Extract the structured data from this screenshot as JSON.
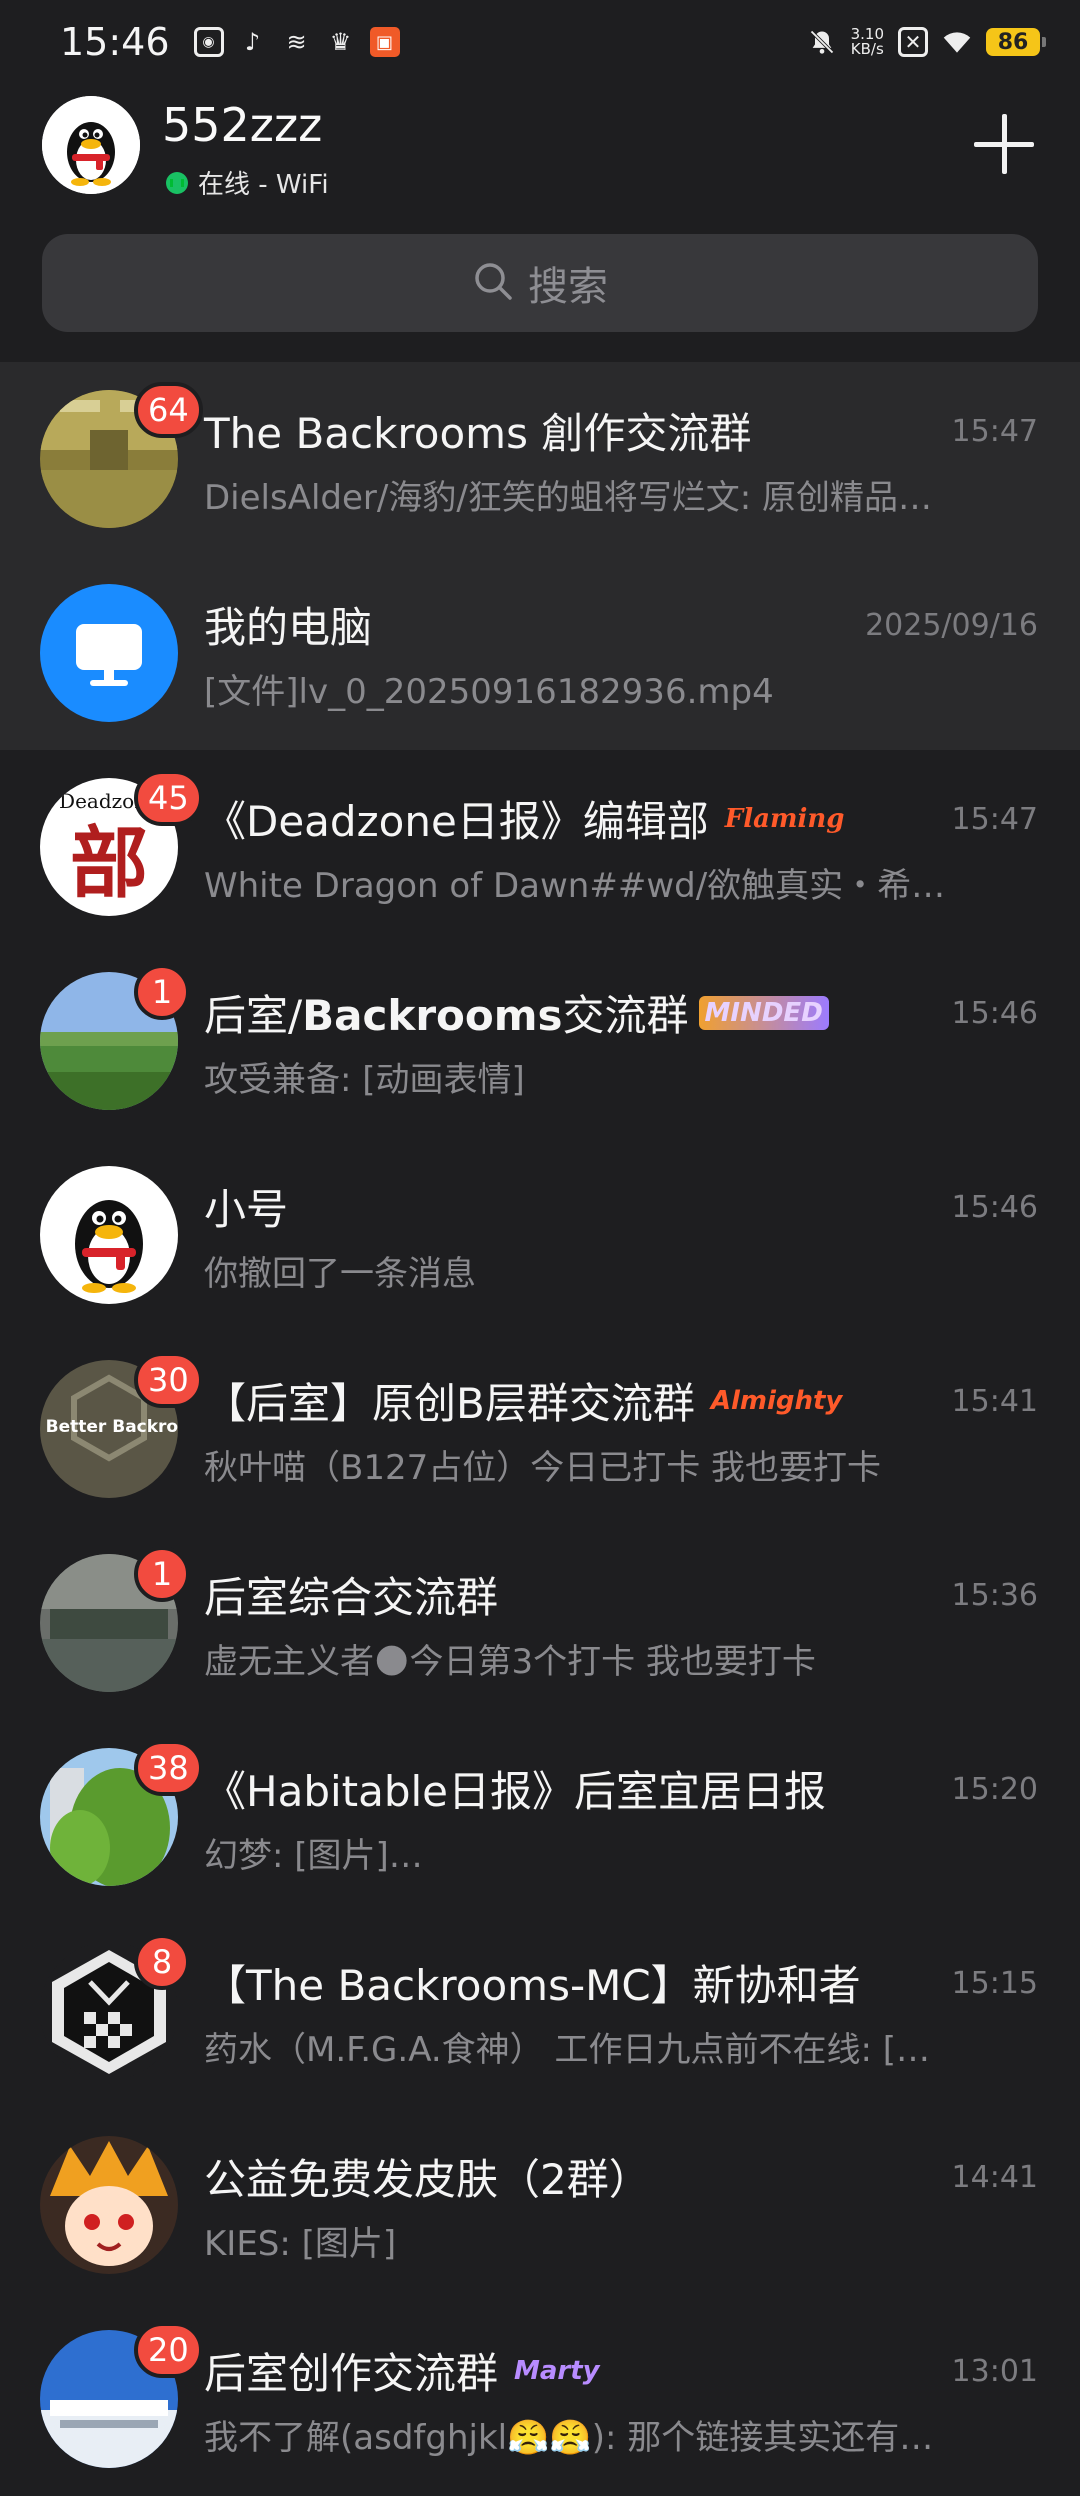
{
  "status_bar": {
    "time": "15:46",
    "net_speed_value": "3.10",
    "net_speed_unit": "KB/s",
    "battery": "86",
    "left_icons": [
      "qq-notify-icon",
      "tiktok-icon",
      "layers-icon",
      "crown-icon",
      "app-icon"
    ],
    "right_icons": [
      "mute-icon",
      "x-icon",
      "wifi-icon"
    ]
  },
  "header": {
    "username": "552zzz",
    "status": "在线 - WiFi",
    "plus_icon": "plus-icon"
  },
  "search": {
    "placeholder": "搜索",
    "icon": "search-icon"
  },
  "chats": [
    {
      "title": "The Backrooms 創作交流群",
      "time": "15:47",
      "preview": "DielsAlder/海豹/狂笑的蛆将写烂文: 原创精品…",
      "badge": "64"
    },
    {
      "title": "我的电脑",
      "time": "2025/09/16",
      "preview": "[文件]lv_0_20250916182936.mp4",
      "badge": ""
    },
    {
      "title": "《Deadzone日报》编辑部",
      "tag": "Flaming",
      "time": "15:47",
      "preview": "White Dragon of Dawn##wd/欲触真实・希…",
      "badge": "45"
    },
    {
      "title_prefix": "后室/",
      "title_bold": "Backrooms",
      "title_suffix": "交流群",
      "tag": "MINDED",
      "time": "15:46",
      "preview": "攻受兼备: [动画表情]",
      "badge": "1"
    },
    {
      "title": "小号",
      "time": "15:46",
      "preview": "你撤回了一条消息",
      "badge": ""
    },
    {
      "title": "【后室】原创B层群交流群",
      "tag": "Almighty",
      "time": "15:41",
      "preview": "秋叶喵（B127占位）今日已打卡  我也要打卡",
      "badge": "30"
    },
    {
      "title": "后室综合交流群",
      "time": "15:36",
      "preview": "虚无主义者🌑今日第3个打卡  我也要打卡",
      "badge": "1"
    },
    {
      "title": "《Habitable日报》后室宜居日报",
      "time": "15:20",
      "preview": "幻梦: [图片]…",
      "badge": "38"
    },
    {
      "title": "【The Backrooms-MC】新协和者",
      "time": "15:15",
      "preview": "药水（M.F.G.A.食神） 工作日九点前不在线: […",
      "badge": "8"
    },
    {
      "title": "公益免费发皮肤（2群）",
      "time": "14:41",
      "preview": "KIES: [图片]",
      "badge": ""
    },
    {
      "title": "后室创作交流群",
      "tag": "Marty",
      "time": "13:01",
      "preview": "我不了解(asdfghjkl😤😤): 那个链接其实还有…",
      "badge": "20"
    }
  ],
  "avatar_texts": {
    "deadzone_top": "Deadzone",
    "deadzone_char": "部",
    "bbc_text": "e Better Backroo"
  }
}
